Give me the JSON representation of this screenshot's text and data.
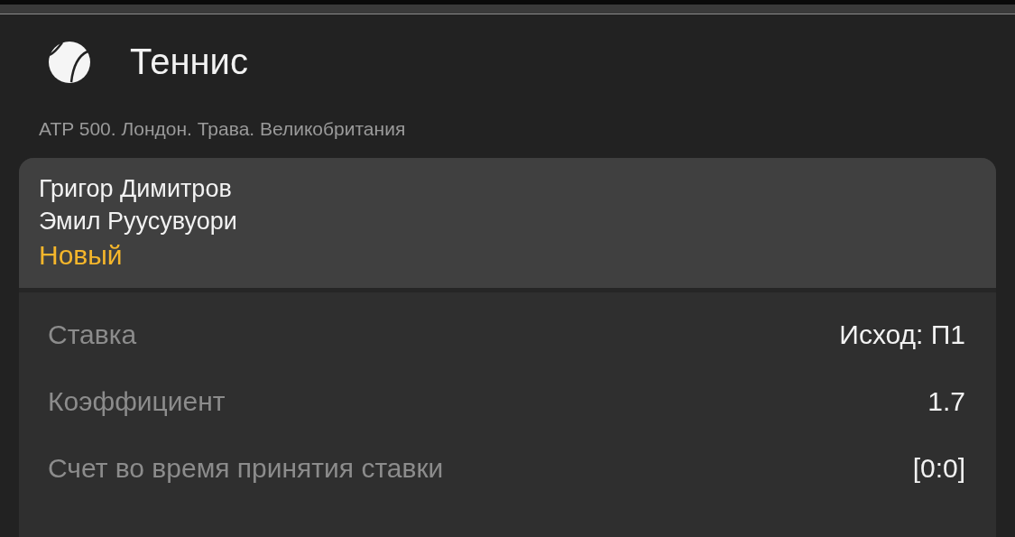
{
  "header": {
    "title": "Теннис"
  },
  "tournament": "ATP 500. Лондон. Трава. Великобритания",
  "match": {
    "players": [
      "Григор Димитров",
      "Эмил Руусувуори"
    ],
    "status": "Новый"
  },
  "details": [
    {
      "label": "Ставка",
      "value": "Исход: П1"
    },
    {
      "label": "Коэффициент",
      "value": "1.7"
    },
    {
      "label": "Счет во время принятия ставки",
      "value": "[0:0]"
    }
  ]
}
